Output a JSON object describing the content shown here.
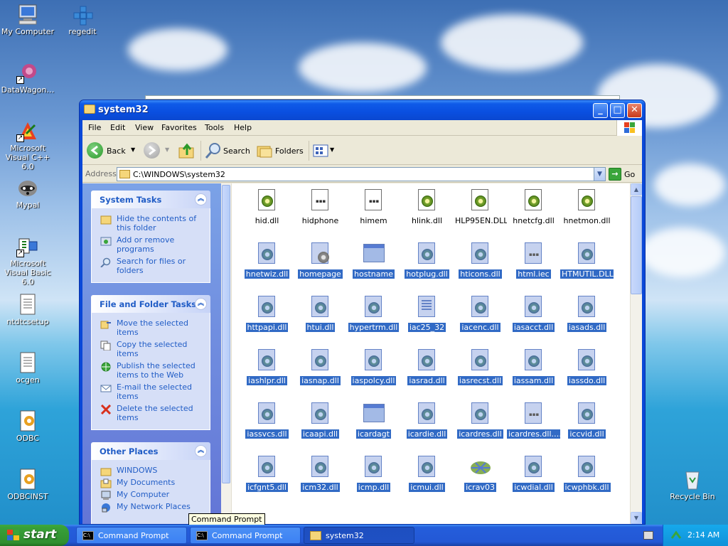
{
  "desktop": {
    "icons": [
      {
        "label": "My Computer"
      },
      {
        "label": "regedit"
      },
      {
        "label": "DataWagon…"
      },
      {
        "label": "Microsoft Visual C++ 6.0"
      },
      {
        "label": "Mypal"
      },
      {
        "label": "Microsoft Visual Basic 6.0"
      },
      {
        "label": "ntdtcsetup"
      },
      {
        "label": "ocgen"
      },
      {
        "label": "ODBC"
      },
      {
        "label": "ODBCINST"
      },
      {
        "label": "Recycle Bin"
      }
    ]
  },
  "window": {
    "title": "system32",
    "menu": [
      "File",
      "Edit",
      "View",
      "Favorites",
      "Tools",
      "Help"
    ],
    "toolbar": {
      "back": "Back",
      "search": "Search",
      "folders": "Folders"
    },
    "address": {
      "label": "Address",
      "value": "C:\\WINDOWS\\system32",
      "go": "Go"
    },
    "system_tasks": {
      "title": "System Tasks",
      "items": [
        "Hide the contents of this folder",
        "Add or remove programs",
        "Search for files or folders"
      ]
    },
    "file_folder_tasks": {
      "title": "File and Folder Tasks",
      "items": [
        "Move the selected items",
        "Copy the selected items",
        "Publish the selected items to the Web",
        "E-mail the selected items",
        "Delete the selected items"
      ]
    },
    "other_places": {
      "title": "Other Places",
      "items": [
        "WINDOWS",
        "My Documents",
        "My Computer",
        "My Network Places"
      ]
    },
    "files": [
      {
        "name": "hid.dll",
        "selected": false,
        "icon": "dll"
      },
      {
        "name": "hidphone",
        "selected": false,
        "icon": "exe"
      },
      {
        "name": "himem",
        "selected": false,
        "icon": "exe"
      },
      {
        "name": "hlink.dll",
        "selected": false,
        "icon": "dll"
      },
      {
        "name": "HLP95EN.DLL",
        "selected": false,
        "icon": "dll"
      },
      {
        "name": "hnetcfg.dll",
        "selected": false,
        "icon": "dll"
      },
      {
        "name": "hnetmon.dll",
        "selected": false,
        "icon": "dll"
      },
      {
        "name": "hnetwiz.dll",
        "selected": true,
        "icon": "dll"
      },
      {
        "name": "homepage",
        "selected": true,
        "icon": "gear"
      },
      {
        "name": "hostname",
        "selected": true,
        "icon": "app"
      },
      {
        "name": "hotplug.dll",
        "selected": true,
        "icon": "dll"
      },
      {
        "name": "hticons.dll",
        "selected": true,
        "icon": "dll"
      },
      {
        "name": "html.iec",
        "selected": true,
        "icon": "exe"
      },
      {
        "name": "HTMUTIL.DLL",
        "selected": true,
        "icon": "dll"
      },
      {
        "name": "httpapi.dll",
        "selected": true,
        "icon": "dll"
      },
      {
        "name": "htui.dll",
        "selected": true,
        "icon": "dll"
      },
      {
        "name": "hypertrm.dll",
        "selected": true,
        "icon": "dll"
      },
      {
        "name": "iac25_32",
        "selected": true,
        "icon": "doc"
      },
      {
        "name": "iacenc.dll",
        "selected": true,
        "icon": "dll"
      },
      {
        "name": "iasacct.dll",
        "selected": true,
        "icon": "dll"
      },
      {
        "name": "iasads.dll",
        "selected": true,
        "icon": "dll"
      },
      {
        "name": "iashlpr.dll",
        "selected": true,
        "icon": "dll"
      },
      {
        "name": "iasnap.dll",
        "selected": true,
        "icon": "dll"
      },
      {
        "name": "iaspolcy.dll",
        "selected": true,
        "icon": "dll"
      },
      {
        "name": "iasrad.dll",
        "selected": true,
        "icon": "dll"
      },
      {
        "name": "iasrecst.dll",
        "selected": true,
        "icon": "dll"
      },
      {
        "name": "iassam.dll",
        "selected": true,
        "icon": "dll"
      },
      {
        "name": "iassdo.dll",
        "selected": true,
        "icon": "dll"
      },
      {
        "name": "iassvcs.dll",
        "selected": true,
        "icon": "dll"
      },
      {
        "name": "icaapi.dll",
        "selected": true,
        "icon": "dll"
      },
      {
        "name": "icardagt",
        "selected": true,
        "icon": "app"
      },
      {
        "name": "icardie.dll",
        "selected": true,
        "icon": "dll"
      },
      {
        "name": "icardres.dll",
        "selected": true,
        "icon": "dll"
      },
      {
        "name": "icardres.dll.…",
        "selected": true,
        "icon": "exe"
      },
      {
        "name": "iccvid.dll",
        "selected": true,
        "icon": "dll"
      },
      {
        "name": "icfgnt5.dll",
        "selected": true,
        "icon": "dll"
      },
      {
        "name": "icm32.dll",
        "selected": true,
        "icon": "dll"
      },
      {
        "name": "icmp.dll",
        "selected": true,
        "icon": "dll"
      },
      {
        "name": "icmui.dll",
        "selected": true,
        "icon": "dll"
      },
      {
        "name": "icrav03",
        "selected": true,
        "icon": "globe"
      },
      {
        "name": "icwdial.dll",
        "selected": true,
        "icon": "dll"
      },
      {
        "name": "icwphbk.dll",
        "selected": true,
        "icon": "dll"
      }
    ]
  },
  "taskbar": {
    "start": "start",
    "items": [
      "Command Prompt",
      "Command Prompt",
      "system32"
    ],
    "tooltip": "Command Prompt",
    "clock": "2:14 AM"
  }
}
